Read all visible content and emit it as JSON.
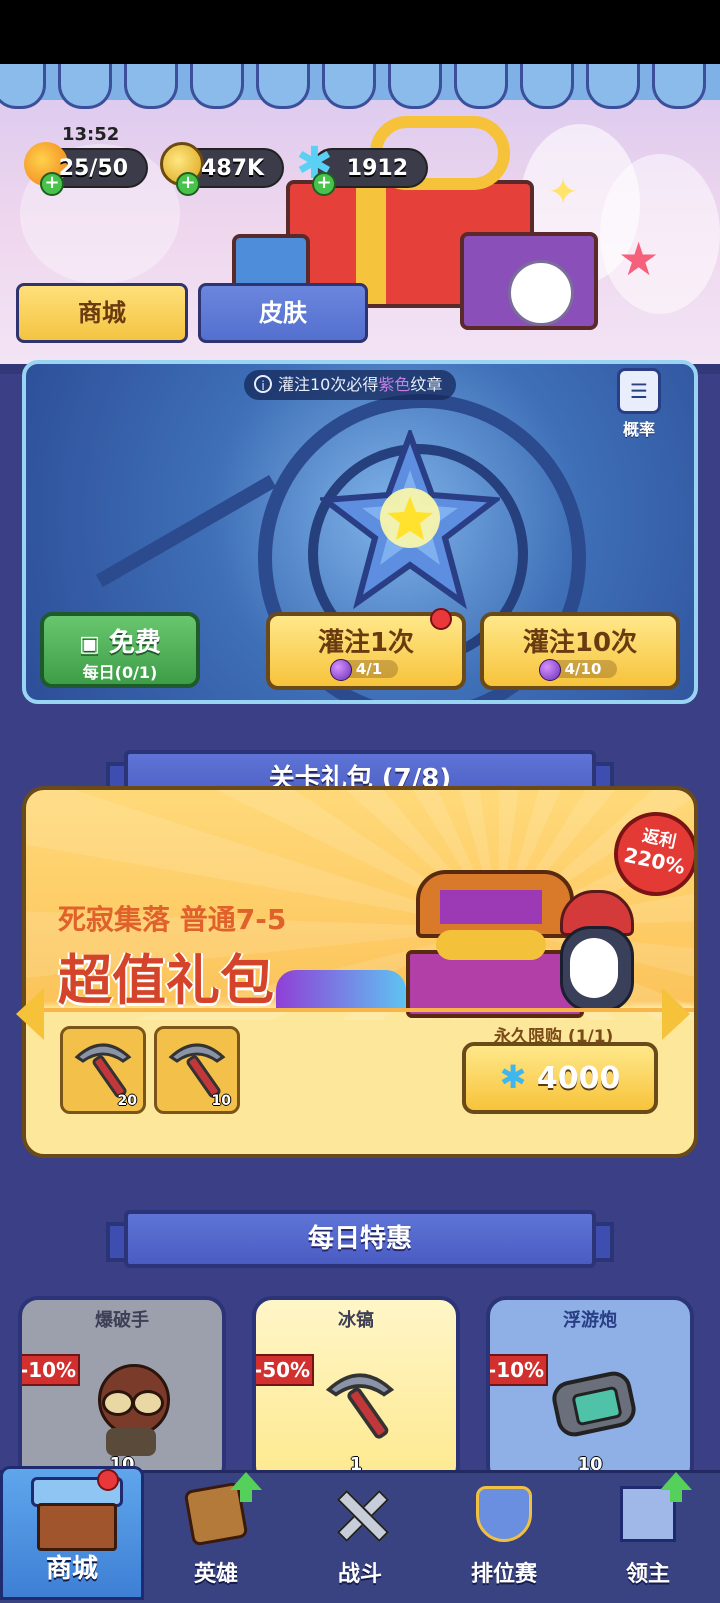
{
  "status": {
    "time": "13:52"
  },
  "resources": {
    "energy": "25/50",
    "gold": "487K",
    "gems": "1912"
  },
  "tabs": [
    {
      "label": "商城",
      "active": true
    },
    {
      "label": "皮肤",
      "active": false
    }
  ],
  "gacha": {
    "notice_prefix": "灌注10次必得",
    "notice_highlight": "紫色",
    "notice_suffix": "纹章",
    "probability_label": "概率",
    "free_label": "免费",
    "free_sub": "每日(0/1)",
    "single_label": "灌注1次",
    "single_cost": "4/1",
    "ten_label": "灌注10次",
    "ten_cost": "4/10"
  },
  "stage_pack": {
    "header": "关卡礼包 (7/8)",
    "stage": "死寂集落 普通7-5",
    "title": "超值礼包",
    "rebate_label": "返利",
    "rebate_value": "220%",
    "limit": "永久限购 (1/1)",
    "items": [
      {
        "icon": "pickaxe-icon",
        "count": "20"
      },
      {
        "icon": "pickaxe-icon",
        "count": "10"
      }
    ],
    "price": "4000"
  },
  "daily": {
    "header": "每日特惠",
    "deals": [
      {
        "name": "爆破手",
        "discount": "-10%",
        "count": "10",
        "icon": "bomber-hero-icon"
      },
      {
        "name": "冰镐",
        "discount": "-50%",
        "count": "1",
        "icon": "pickaxe-icon"
      },
      {
        "name": "浮游炮",
        "discount": "-10%",
        "count": "10",
        "icon": "floating-cannon-icon"
      }
    ]
  },
  "nav": [
    {
      "label": "商城",
      "icon": "shop-icon",
      "active": true
    },
    {
      "label": "英雄",
      "icon": "hero-card-icon",
      "active": false
    },
    {
      "label": "战斗",
      "icon": "crossed-swords-icon",
      "active": false
    },
    {
      "label": "排位赛",
      "icon": "rank-shield-icon",
      "active": false
    },
    {
      "label": "领主",
      "icon": "lord-banner-icon",
      "active": false
    }
  ],
  "colors": {
    "background": "#3a3f86",
    "accent_yellow": "#f7c33b",
    "purple_highlight": "#c67de6",
    "discount_red": "#d2302f"
  }
}
